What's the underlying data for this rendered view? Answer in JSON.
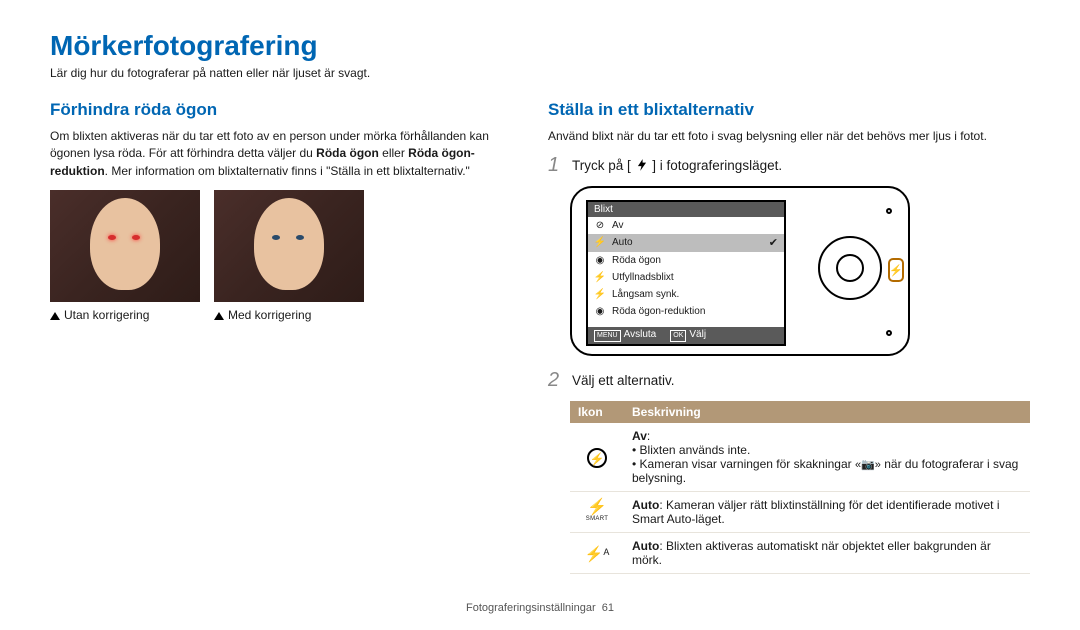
{
  "page": {
    "title": "Mörkerfotografering",
    "subtitle": "Lär dig hur du fotograferar på natten eller när ljuset är svagt."
  },
  "left": {
    "heading": "Förhindra röda ögon",
    "p1a": "Om blixten aktiveras när du tar ett foto av en person under mörka förhållanden kan ögonen lysa röda. För att förhindra detta väljer du ",
    "p1bold1": "Röda ögon",
    "p1b": " eller ",
    "p1bold2": "Röda ögon-reduktion",
    "p1c": ". Mer information om blixtalternativ finns i \"Ställa in ett blixtalternativ.\"",
    "cap_without": "Utan korrigering",
    "cap_with": "Med korrigering"
  },
  "right": {
    "heading": "Ställa in ett blixtalternativ",
    "intro": "Använd blixt när du tar ett foto i svag belysning eller när det behövs mer ljus i fotot.",
    "step1_num": "1",
    "step1a": "Tryck på [ ",
    "step1b": " ] i fotograferingsläget.",
    "step2_num": "2",
    "step2": "Välj ett alternativ."
  },
  "camera_menu": {
    "header": "Blixt",
    "items": [
      {
        "label": "Av"
      },
      {
        "label": "Auto",
        "selected": true
      },
      {
        "label": "Röda ögon"
      },
      {
        "label": "Utfyllnadsblixt"
      },
      {
        "label": "Långsam synk."
      },
      {
        "label": "Röda ögon-reduktion"
      }
    ],
    "footer_menu": "MENU",
    "footer_exit": "Avsluta",
    "footer_ok": "OK",
    "footer_select": "Välj"
  },
  "table": {
    "h1": "Ikon",
    "h2": "Beskrivning",
    "r1_title": "Av",
    "r1_b1": "Blixten används inte.",
    "r1_b2a": "Kameran visar varningen för skakningar ",
    "r1_b2b": " när du fotograferar i svag belysning.",
    "r2_bold": "Auto",
    "r2_text": ": Kameran väljer rätt blixtinställning för det identifierade motivet i Smart Auto-läget.",
    "r3_bold": "Auto",
    "r3_text": ": Blixten aktiveras automatiskt när objektet eller bakgrunden är mörk."
  },
  "footer": {
    "label": "Fotograferingsinställningar",
    "page": "61"
  }
}
